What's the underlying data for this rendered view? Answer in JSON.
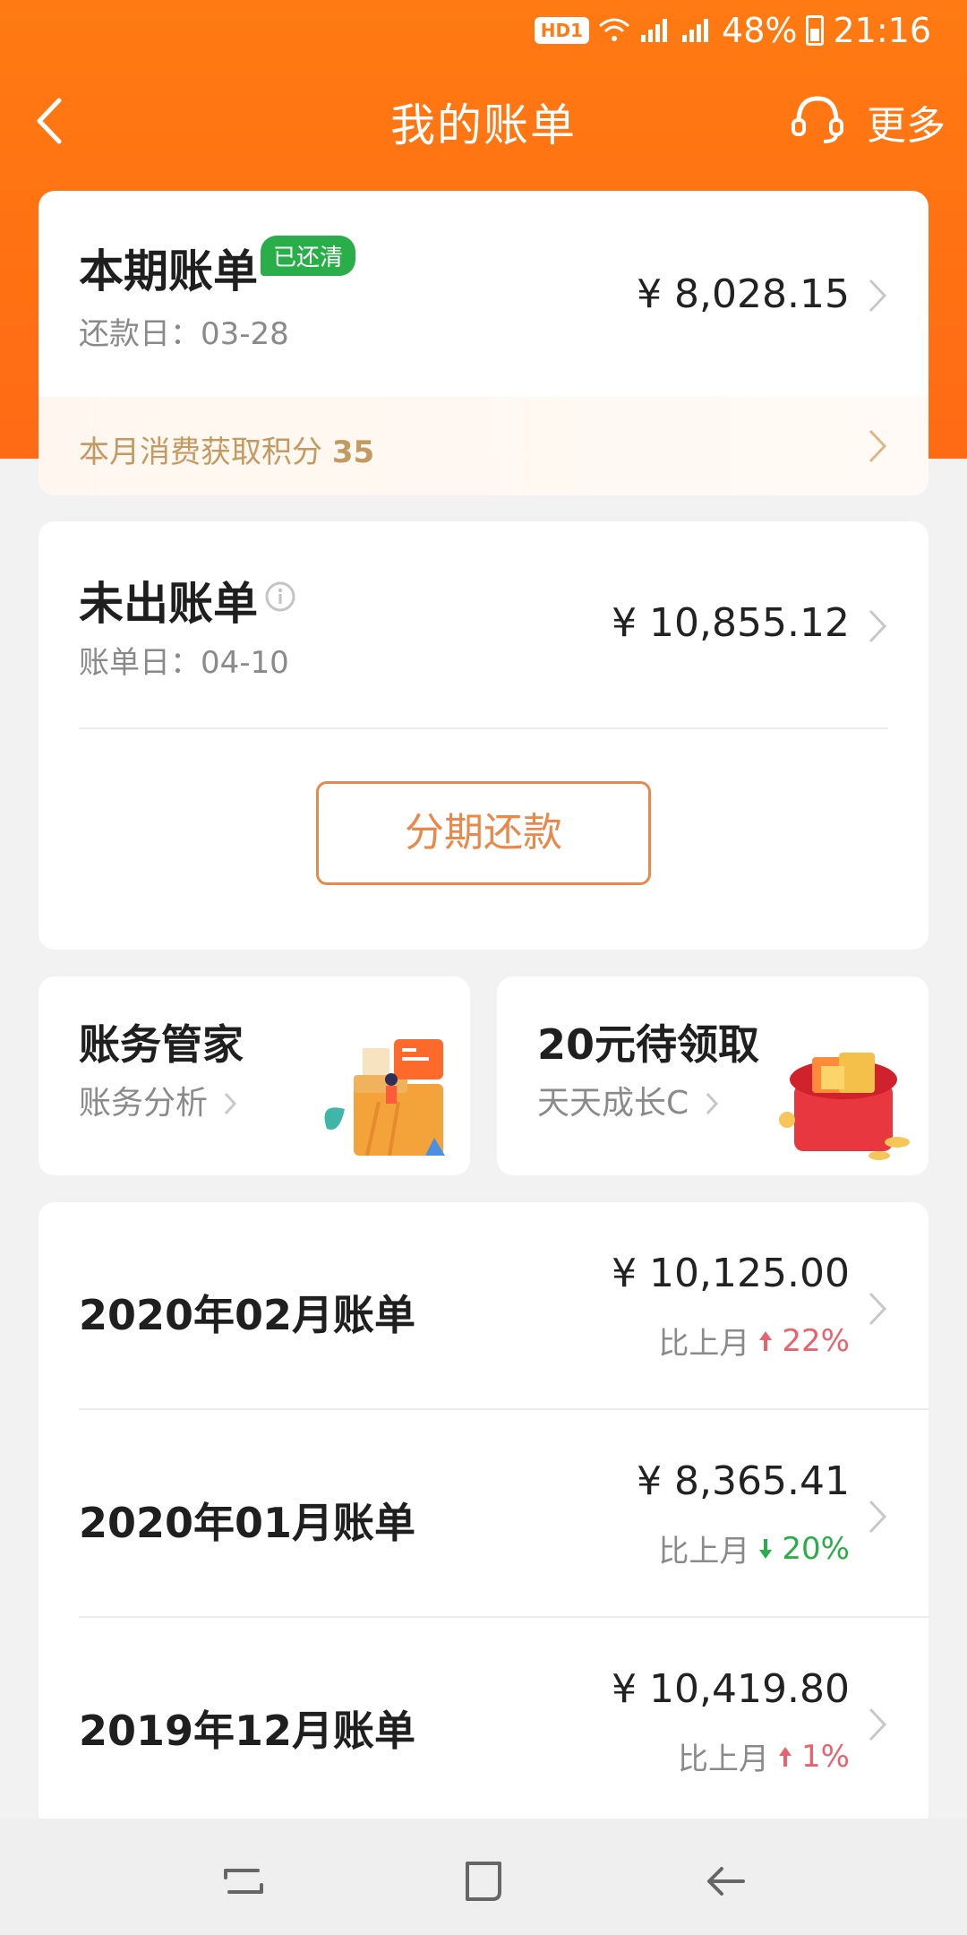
{
  "status_bar": {
    "hd": "HD1",
    "battery": "48%",
    "time": "21:16"
  },
  "header": {
    "title": "我的账单",
    "more": "更多"
  },
  "current_bill": {
    "title": "本期账单",
    "badge": "已还清",
    "due_label": "还款日：03-28",
    "amount": "¥ 8,028.15",
    "points_label": "本月消费获取积分",
    "points_value": "35"
  },
  "unbilled": {
    "title": "未出账单",
    "bill_date": "账单日：04-10",
    "amount": "¥ 10,855.12",
    "installment_button": "分期还款"
  },
  "promo": [
    {
      "title": "账务管家",
      "sub": "账务分析"
    },
    {
      "title": "20元待领取",
      "sub": "天天成长C"
    }
  ],
  "bills": [
    {
      "name": "2020年02月账单",
      "amount": "¥ 10,125.00",
      "compare_label": "比上月",
      "change": "22%",
      "direction": "up"
    },
    {
      "name": "2020年01月账单",
      "amount": "¥ 8,365.41",
      "compare_label": "比上月",
      "change": "20%",
      "direction": "down"
    },
    {
      "name": "2019年12月账单",
      "amount": "¥ 10,419.80",
      "compare_label": "比上月",
      "change": "1%",
      "direction": "up"
    }
  ],
  "colors": {
    "brand": "#ff7a12",
    "paid_green": "#2aae4a",
    "up_red": "#e8636f",
    "down_green": "#2aae4a",
    "points_gold": "#c39a61"
  }
}
